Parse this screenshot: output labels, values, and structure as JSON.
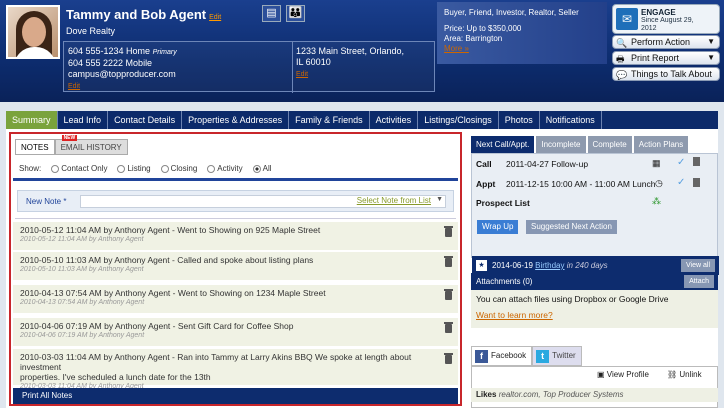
{
  "contact": {
    "name": "Tammy and Bob Agent",
    "name_edit": "Edit",
    "company": "Dove Realty",
    "phones": [
      {
        "number": "604 555-1234 Home",
        "tag": "Primary"
      },
      {
        "number": "604 555 2222 Mobile",
        "tag": ""
      }
    ],
    "email": "campus@topproducer.com",
    "edit": "Edit",
    "address": [
      "1233 Main Street, Orlando,",
      "IL 60010"
    ],
    "address_edit": "Edit"
  },
  "header_notes": {
    "types": "Buyer, Friend, Investor, Realtor, Seller",
    "price": "Price: Up to $350,000",
    "area": "Area: Barrington",
    "more": "More »"
  },
  "engage": {
    "title": "ENGAGE",
    "since": "Since August 29,",
    "year": "2012"
  },
  "actions": {
    "perform": "Perform Action",
    "print": "Print Report",
    "things": "Things to Talk About"
  },
  "nav": [
    "Summary",
    "Lead Info",
    "Contact Details",
    "Properties & Addresses",
    "Family & Friends",
    "Activities",
    "Listings/Closings",
    "Photos",
    "Notifications"
  ],
  "notes": {
    "tab_notes": "NOTES",
    "tab_email": "EMAIL HISTORY",
    "new_badge": "NEW",
    "show_label": "Show:",
    "filters": [
      "Contact Only",
      "Listing",
      "Closing",
      "Activity",
      "All"
    ],
    "new_note_label": "New Note *",
    "select_note": "Select Note from List",
    "items": [
      {
        "line": "2010-05-12 11:04 AM by Anthony Agent - Went to Showing on 925 Maple Street",
        "meta": "2010-05-12 11:04 AM by Anthony Agent"
      },
      {
        "line": "2010-05-10 11:03 AM by Anthony Agent - Called and spoke about listing plans",
        "meta": "2010-05-10 11:03 AM by Anthony Agent"
      },
      {
        "line": "2010-04-13 07:54 AM by Anthony Agent - Went to Showing on 1234 Maple Street",
        "meta": "2010-04-13 07:54 AM by Anthony Agent"
      },
      {
        "line": "2010-04-06 07:19 AM by Anthony Agent - Sent Gift Card for Coffee Shop",
        "meta": "2010-04-06 07:19 AM by Anthony Agent"
      },
      {
        "line": "2010-03-03 11:04 AM by Anthony Agent - Ran into Tammy at Larry Akins BBQ We spoke at length about investment",
        "line2": "properties. I've scheduled a lunch date for the 13th",
        "meta": "2010-03-03 11:04 AM by Anthony Agent"
      }
    ],
    "print_all": "Print All Notes"
  },
  "next": {
    "tabs": [
      "Next Call/Appt.",
      "Incomplete",
      "Complete",
      "Action Plans"
    ],
    "call_label": "Call",
    "call_value": "2011-04-27 Follow-up",
    "appt_label": "Appt",
    "appt_value": "2011-12-15 10:00 AM - 11:00 AM Lunch",
    "prospect": "Prospect List",
    "wrap_up": "Wrap Up",
    "suggested": "Suggested Next Action",
    "birthday_date": "2014-06-19",
    "birthday_link": "Birthday",
    "birthday_in": "in 240 days",
    "view_all": "View all"
  },
  "attachments": {
    "title": "Attachments (0)",
    "attach": "Attach",
    "body": "You can attach files using Dropbox or Google Drive",
    "learn": "Want to learn more?"
  },
  "social": {
    "facebook": "Facebook",
    "twitter": "Twitter",
    "view_profile": "View Profile",
    "unlink": "Unlink",
    "likes_label": "Likes",
    "likes_value": "realtor.com, Top Producer Systems"
  }
}
